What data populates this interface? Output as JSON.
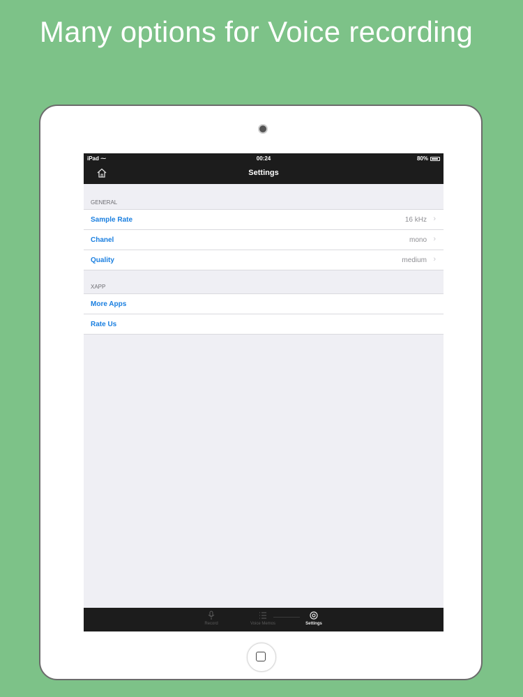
{
  "headline": "Many options for Voice recording",
  "statusbar": {
    "carrier": "iPad",
    "time": "00:24",
    "battery": "80%"
  },
  "navbar": {
    "title": "Settings",
    "home_icon": "home-icon"
  },
  "sections": [
    {
      "header": "GENERAL",
      "rows": [
        {
          "label": "Sample Rate",
          "value": "16 kHz"
        },
        {
          "label": "Chanel",
          "value": "mono"
        },
        {
          "label": "Quality",
          "value": "medium"
        }
      ]
    },
    {
      "header": "XAPP",
      "rows": [
        {
          "label": "More Apps"
        },
        {
          "label": "Rate Us"
        }
      ]
    }
  ],
  "tabbar": {
    "tabs": [
      {
        "label": "Record",
        "icon": "microphone-icon",
        "active": false
      },
      {
        "label": "Voice Memos",
        "icon": "list-icon",
        "active": false
      },
      {
        "label": "Settings",
        "icon": "gear-icon",
        "active": true
      }
    ]
  },
  "colors": {
    "background": "#7dc288",
    "accent": "#1a7fe0",
    "bar": "#1c1c1c"
  }
}
